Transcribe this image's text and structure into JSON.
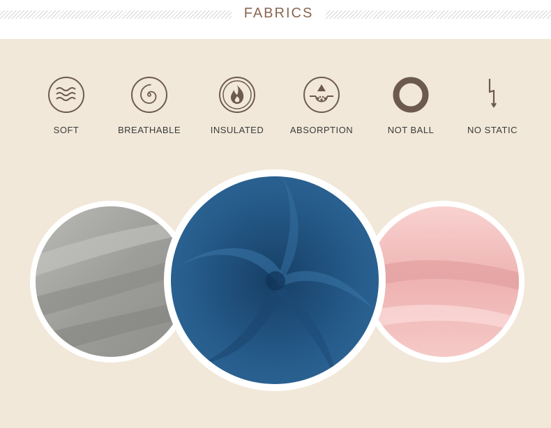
{
  "header": {
    "title": "FABRICS"
  },
  "features": [
    {
      "label": "SOFT",
      "icon": "waves-icon"
    },
    {
      "label": "BREATHABLE",
      "icon": "spiral-icon"
    },
    {
      "label": "INSULATED",
      "icon": "flame-icon"
    },
    {
      "label": "ABSORPTION",
      "icon": "water-drop-icon"
    },
    {
      "label": "NOT BALL",
      "icon": "ring-icon"
    },
    {
      "label": "NO STATIC",
      "icon": "lightning-icon"
    }
  ],
  "swatches": [
    {
      "name": "grey",
      "color": "#a5a6a3"
    },
    {
      "name": "blue",
      "color": "#275d8c"
    },
    {
      "name": "pink",
      "color": "#f0b8b8"
    }
  ],
  "colors": {
    "background": "#f1e8d9",
    "accent": "#8a6650",
    "icon": "#6d5a4e"
  }
}
